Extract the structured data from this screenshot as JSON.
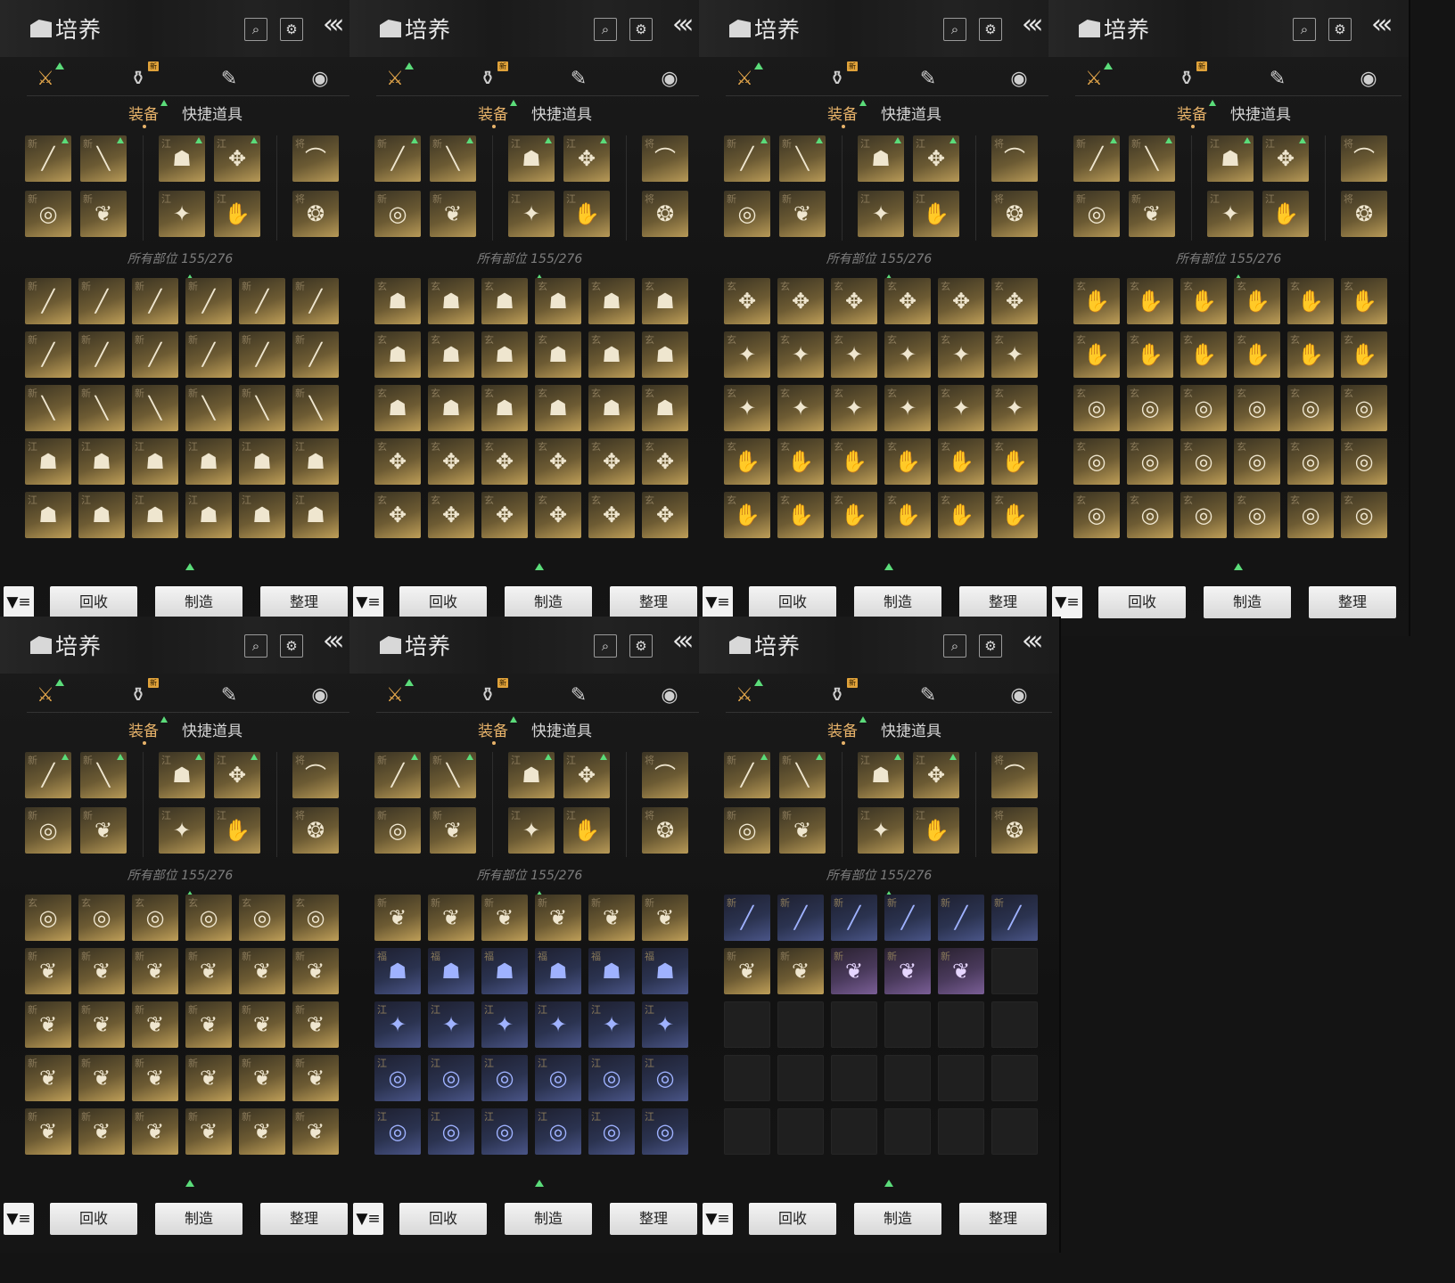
{
  "panel_title": "培养",
  "icons": {
    "title_icon": "backpack-icon",
    "search": "search-icon",
    "settings": "gear-icon",
    "back": "double-chevron-left-icon",
    "filter": "filter-icon"
  },
  "categories": [
    {
      "name": "weapon",
      "glyph": "⚔",
      "active": true,
      "indicator": "up-arrow"
    },
    {
      "name": "consumable",
      "glyph": "⚱",
      "active": false,
      "badge": "新"
    },
    {
      "name": "scroll",
      "glyph": "✎",
      "active": false
    },
    {
      "name": "material",
      "glyph": "◉",
      "active": false
    }
  ],
  "tabs": {
    "equip": "装备",
    "quick_items": "快捷道具"
  },
  "inventory_count": "所有部位 155/276",
  "buttons": {
    "recycle": "回收",
    "craft": "制造",
    "sort": "整理",
    "filter_glyph": "▼≡"
  },
  "equipped": {
    "row1": [
      {
        "mark": "新",
        "glyph": "╱"
      },
      {
        "mark": "新",
        "glyph": "╲"
      },
      {
        "mark": "江",
        "glyph": "☗"
      },
      {
        "mark": "江",
        "glyph": "✥"
      },
      {
        "mark": "将",
        "glyph": "⌒"
      }
    ],
    "row2": [
      {
        "mark": "新",
        "glyph": "◎"
      },
      {
        "mark": "新",
        "glyph": "❦"
      },
      {
        "mark": "江",
        "glyph": "✦"
      },
      {
        "mark": "江",
        "glyph": "✋"
      },
      {
        "mark": "将",
        "glyph": "❂"
      }
    ]
  },
  "palettes": {
    "gold": "#bf9f58",
    "blue": "#4a5588",
    "purple": "#7a5e96",
    "accent": "#e8b36a",
    "indicator": "#5bdc7a"
  },
  "panels": [
    {
      "bag_rows": [
        {
          "kind": "gold",
          "glyph": "╱",
          "mark": "新"
        },
        {
          "kind": "gold",
          "glyph": "╱",
          "mark": "新"
        },
        {
          "kind": "gold",
          "glyph": "╲",
          "mark": "新"
        },
        {
          "kind": "gold",
          "glyph": "☗",
          "mark": "江"
        }
      ]
    },
    {
      "bag_rows": [
        {
          "kind": "gold",
          "glyph": "☗",
          "mark": "玄"
        },
        {
          "kind": "gold",
          "glyph": "☗",
          "mark": "玄"
        },
        {
          "kind": "gold",
          "glyph": "☗",
          "mark": "玄"
        },
        {
          "kind": "gold",
          "glyph": "✥",
          "mark": "玄"
        }
      ]
    },
    {
      "bag_rows": [
        {
          "kind": "gold",
          "glyph": "✥",
          "mark": "玄"
        },
        {
          "kind": "gold",
          "glyph": "✦",
          "mark": "玄"
        },
        {
          "kind": "gold",
          "glyph": "✦",
          "mark": "玄"
        },
        {
          "kind": "gold",
          "glyph": "✋",
          "mark": "玄"
        }
      ]
    },
    {
      "bag_rows": [
        {
          "kind": "gold",
          "glyph": "✋",
          "mark": "玄"
        },
        {
          "kind": "gold",
          "glyph": "✋",
          "mark": "玄"
        },
        {
          "kind": "gold",
          "glyph": "◎",
          "mark": "玄"
        },
        {
          "kind": "gold",
          "glyph": "◎",
          "mark": "玄"
        }
      ]
    },
    {
      "bag_rows": [
        {
          "kind": "gold",
          "glyph": "◎",
          "mark": "玄"
        },
        {
          "kind": "gold",
          "glyph": "❦",
          "mark": "新"
        },
        {
          "kind": "gold",
          "glyph": "❦",
          "mark": "新"
        },
        {
          "kind": "gold",
          "glyph": "❦",
          "mark": "新"
        }
      ]
    },
    {
      "bag_rows": [
        {
          "kind": "gold",
          "glyph": "❦",
          "mark": "新"
        },
        {
          "kind": "blue",
          "glyph": "☗",
          "mark": "福"
        },
        {
          "kind": "blue",
          "glyph": "✦",
          "mark": "江"
        },
        {
          "kind": "blue",
          "glyph": "◎",
          "mark": "江"
        }
      ]
    },
    {
      "bag_rows": [
        {
          "kind": "blue",
          "glyph": "╱",
          "mark": "新"
        },
        {
          "kind": "mixed",
          "glyph": "❦",
          "mark": "新"
        },
        {
          "kind": "empty",
          "glyph": "",
          "mark": ""
        },
        {
          "kind": "empty",
          "glyph": "",
          "mark": ""
        }
      ]
    }
  ]
}
